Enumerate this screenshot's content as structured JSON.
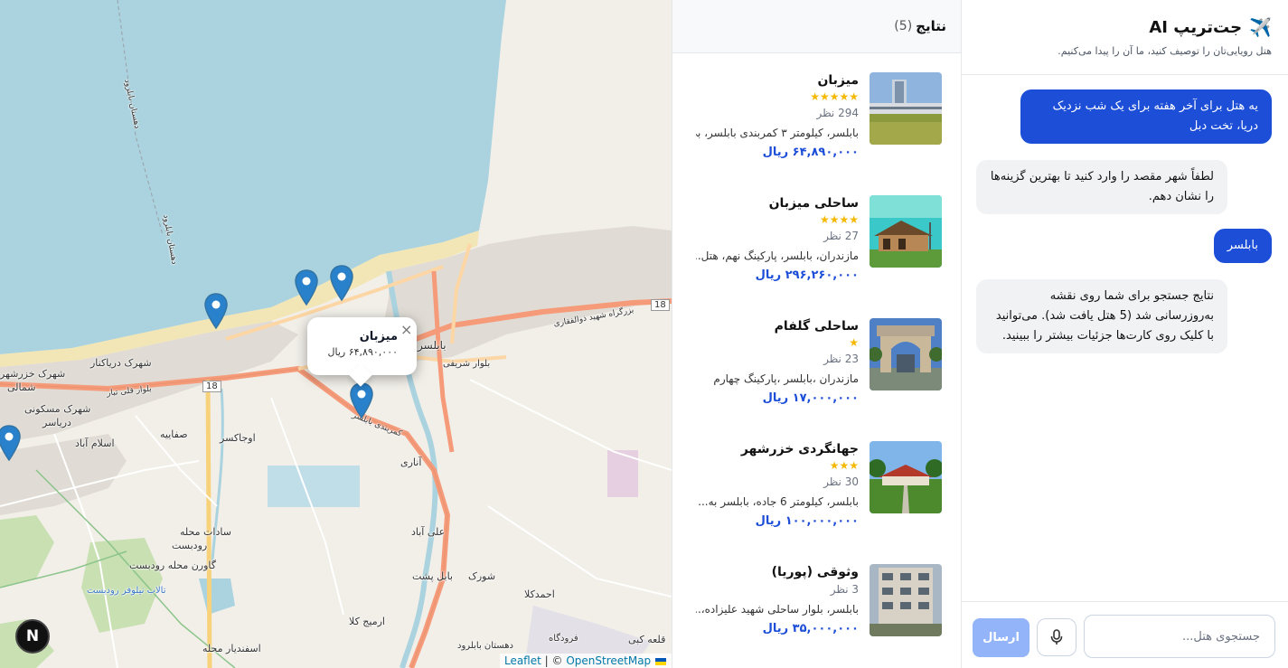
{
  "map": {
    "popup": {
      "name": "میزبان",
      "price": "۶۴,۸۹۰,۰۰۰ ریال",
      "close": "×"
    },
    "attribution": {
      "leaflet": "Leaflet",
      "sep": " | © ",
      "osm": "OpenStreetMap"
    },
    "badge": "N",
    "labels": {
      "l1": "شهرک دریاکنار",
      "l2": "شهرک خزرشهر",
      "l3": "شمالی",
      "l4": "شهرک مسکونی",
      "l5": "دریاسر",
      "l6": "اسلام آباد",
      "l7": "صفاییه",
      "l8": "اوجاکسر",
      "l9": "بابلسر",
      "l10": "بلوار شریفی",
      "l11": "آناری",
      "l12": "سادات محله",
      "l13": "رودبست",
      "l14": "گاورن محله رودبست",
      "l15": "علی آباد",
      "l16": "بابل پشت",
      "l17": "شورک",
      "l18": "احمدکلا",
      "l19": "ارمیج کلا",
      "l20": "اسفندیار محله",
      "l21": "دهستان بابلرود",
      "l22": "قلعه کبی",
      "l23": "تالاب نیلوفر رودبست",
      "l24": "بلوار قلی تبار",
      "l25": "18",
      "l26": "18",
      "l27": "کمربندی بابلسر",
      "l28": "بزرگراه شهید ذوالفقاری",
      "l29": "دهستان بابلرود",
      "l30": "فرودگاه",
      "l31": "دهستان بابلرود"
    },
    "marker_colors": {
      "pin": "#2a81cb",
      "pin_dark": "#3274a3"
    }
  },
  "results": {
    "title": "نتایج",
    "count": "(5)",
    "hotels": [
      {
        "name": "میزبان",
        "stars": "★★★★★",
        "reviews": "294 نظر",
        "address": "بابلسر، کیلومتر ۳ کمربندی بابلسر، بی...",
        "price": "۶۴,۸۹۰,۰۰۰ ریال"
      },
      {
        "name": "ساحلی میزبان",
        "stars": "★★★★",
        "reviews": "27 نظر",
        "address": "مازندران، بابلسر، پارکینگ نهم، هتل...",
        "price": "۲۹۶,۲۶۰,۰۰۰ ریال"
      },
      {
        "name": "ساحلی گلفام",
        "stars": "★",
        "reviews": "23 نظر",
        "address": "مازندران ،بابلسر ،پارکینگ چهارم",
        "price": "۱۷,۰۰۰,۰۰۰ ریال"
      },
      {
        "name": "جهانگردی خزرشهر",
        "stars": "★★★",
        "reviews": "30 نظر",
        "address": "بابلسر، کیلومتر 6 جاده، بابلسر به...",
        "price": "۱۰۰,۰۰۰,۰۰۰ ریال"
      },
      {
        "name": "وثوقی (پوریا)",
        "stars": "",
        "reviews": "3 نظر",
        "address": "بابلسر، بلوار ساحلی شهید علیزاده،...",
        "price": "۳۵,۰۰۰,۰۰۰ ریال"
      }
    ]
  },
  "chat": {
    "title": "جت‌تریپ AI",
    "subtitle": "هتل رویایی‌تان را توصیف کنید، ما آن را پیدا می‌کنیم.",
    "messages": [
      {
        "role": "user",
        "text": "یه هتل برای آخر هفته برای یک شب نزدیک دریا، تخت دبل"
      },
      {
        "role": "bot",
        "text": "لطفاً شهر مقصد را وارد کنید تا بهترین گزینه‌ها را نشان دهم."
      },
      {
        "role": "user",
        "text": "بابلسر"
      },
      {
        "role": "bot",
        "text": "نتایج جستجو برای شما روی نقشه به‌روزرسانی شد (5 هتل یافت شد). می‌توانید با کلیک روی کارت‌ها جزئیات بیشتر را ببینید."
      }
    ],
    "input_placeholder": "جستجوی هتل...",
    "input_value": "",
    "send_label": "ارسال"
  },
  "colors": {
    "accent": "#1d4ed8",
    "send_disabled": "#93b4f8",
    "star": "#f5b800"
  }
}
